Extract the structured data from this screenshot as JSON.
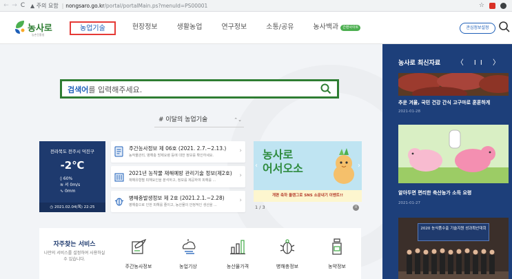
{
  "browser": {
    "back": "←",
    "forward": "→",
    "reload": "C",
    "security": "▲ 주의 요함",
    "host": "nongsaro.go.kr",
    "path": "/portal/portalMain.ps?menuId=PS00001",
    "star": "☆"
  },
  "site": {
    "logo_text": "농사로",
    "logo_sub": "농촌진흥청",
    "nav": [
      {
        "label": "농업기술"
      },
      {
        "label": "현장정보"
      },
      {
        "label": "생활농업"
      },
      {
        "label": "연구정보"
      },
      {
        "label": "소통/공유"
      },
      {
        "label": "농사백과"
      }
    ],
    "nav_badge": "간편사이트",
    "interest_button": "관심정보설정"
  },
  "search": {
    "bold": "검색어",
    "rest": "를 입력해주세요."
  },
  "monthly_select": {
    "value": "# 이달의 농업기술",
    "chevron": "⌃⌄"
  },
  "weather": {
    "location": "전라북도 전주시 덕진구",
    "temp": "-2℃",
    "humidity": "60%",
    "wind": "서 0m/s",
    "rain": "0mm",
    "date": "2021.02.04(목) 22:25"
  },
  "news": [
    {
      "title": "주간농사정보 제 06호 (2021. 2.7.~2.13.)",
      "desc": "농작물관리, 병해충 방제요령 등에 대한 정보를 확인하세요."
    },
    {
      "title": "2021년 농작물 재해예방 관리기술 정보(제2호)",
      "desc": "재해유형별 피해요인을 분석하고, 정보를 제공하여 피해를 ..."
    },
    {
      "title": "병해충발생정보 제 2호 (2021.2.1.~2.28)",
      "desc": "병해충으로 인한 피해를 줄이고, 농산물의 안정적인 생산을 ..."
    }
  ],
  "banner": {
    "line1": "농사로",
    "line2": "어서오소",
    "caption": "개편 축하 올렌그로 SNS 소문내기 이벤트!!",
    "pager": "1 / 3",
    "pause": "II"
  },
  "services": {
    "title": "자주찾는 서비스",
    "desc": "나만의 서비스를 설정하여 사용하실 수 있습니다.",
    "items": [
      {
        "label": "주간농사정보",
        "icon": "notebook-icon"
      },
      {
        "label": "농업기상",
        "icon": "weather-icon"
      },
      {
        "label": "농산물가격",
        "icon": "price-chart-icon"
      },
      {
        "label": "병해충정보",
        "icon": "bug-icon"
      },
      {
        "label": "농약정보",
        "icon": "pesticide-bottle-icon"
      }
    ]
  },
  "sidebar": {
    "heading": "농사로 최신자료",
    "controls": "〈 II 〉",
    "items": [
      {
        "title": "추운 겨울, 국민 건강 간식 고구마로 훈훈하게",
        "date": "2021-01-28"
      },
      {
        "title": "알아두면 편리한 축산농가 소득 요령",
        "date": "2021-01-27"
      },
      {
        "title": "2020 농식품수출 기술지원 성과확산대회",
        "date": ""
      }
    ]
  },
  "colors": {
    "brand_green": "#2e7d32",
    "brand_blue": "#1d5fb8",
    "sidebar_bg": "#1d3f7a",
    "highlight_red": "#e53935"
  }
}
